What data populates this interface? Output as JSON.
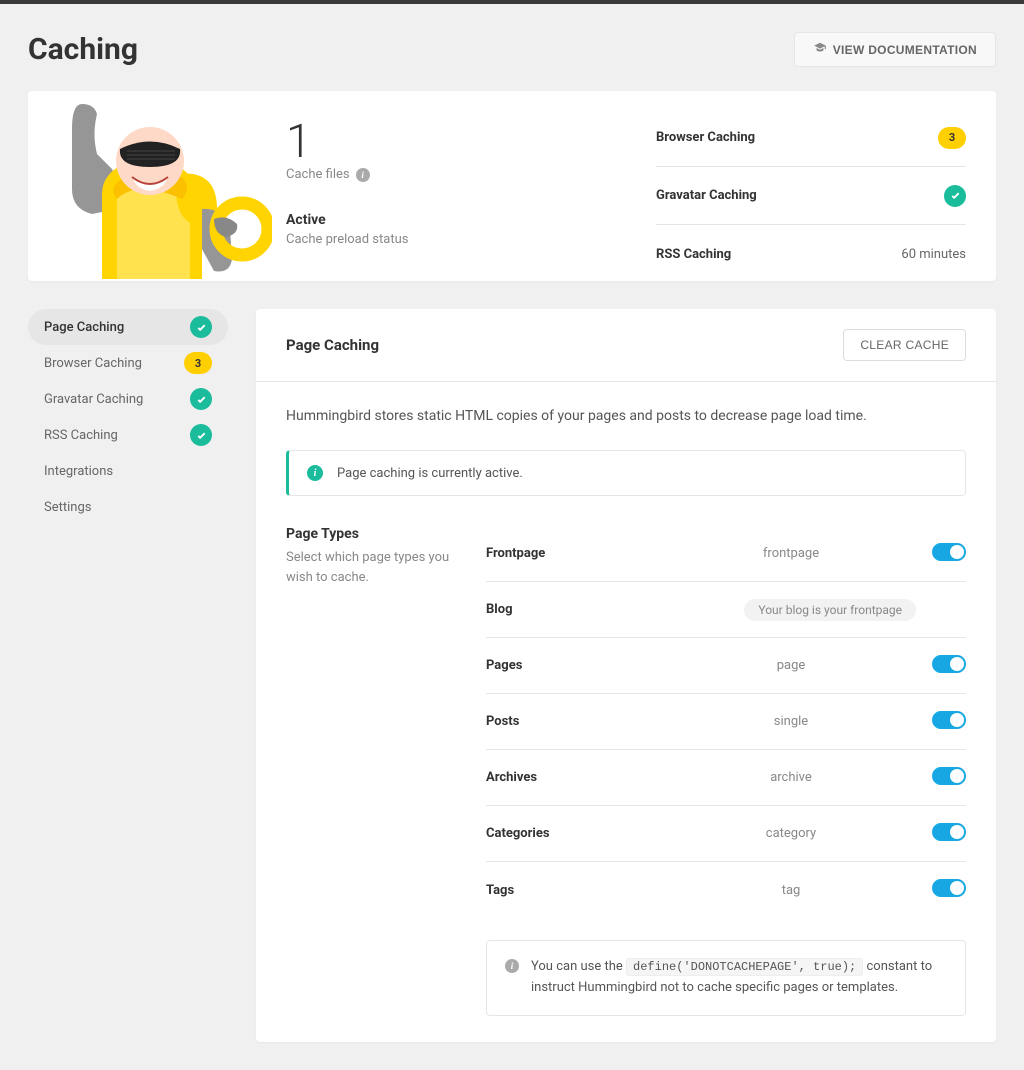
{
  "header": {
    "title": "Caching",
    "doc_button": "VIEW DOCUMENTATION"
  },
  "summary": {
    "count": "1",
    "count_label": "Cache files",
    "status_title": "Active",
    "status_sub": "Cache preload status",
    "rows": [
      {
        "label": "Browser Caching",
        "badge": "3",
        "badge_type": "yellow"
      },
      {
        "label": "Gravatar Caching",
        "badge_type": "check"
      },
      {
        "label": "RSS Caching",
        "value": "60 minutes"
      }
    ]
  },
  "sidebar": [
    {
      "label": "Page Caching",
      "active": true,
      "indicator": "check"
    },
    {
      "label": "Browser Caching",
      "indicator": "yellow",
      "badge": "3"
    },
    {
      "label": "Gravatar Caching",
      "indicator": "check"
    },
    {
      "label": "RSS Caching",
      "indicator": "check"
    },
    {
      "label": "Integrations"
    },
    {
      "label": "Settings"
    }
  ],
  "main": {
    "title": "Page Caching",
    "clear_btn": "CLEAR CACHE",
    "intro": "Hummingbird stores static HTML copies of your pages and posts to decrease page load time.",
    "notice": "Page caching is currently active.",
    "section_title": "Page Types",
    "section_desc": "Select which page types you wish to cache.",
    "types": [
      {
        "label": "Frontpage",
        "value": "frontpage",
        "toggle": true
      },
      {
        "label": "Blog",
        "pill": "Your blog is your frontpage"
      },
      {
        "label": "Pages",
        "value": "page",
        "toggle": true
      },
      {
        "label": "Posts",
        "value": "single",
        "toggle": true
      },
      {
        "label": "Archives",
        "value": "archive",
        "toggle": true
      },
      {
        "label": "Categories",
        "value": "category",
        "toggle": true
      },
      {
        "label": "Tags",
        "value": "tag",
        "toggle": true
      }
    ],
    "tip_pre": "You can use the ",
    "tip_code": "define('DONOTCACHEPAGE', true);",
    "tip_post": " constant to instruct Hummingbird not to cache specific pages or templates."
  }
}
